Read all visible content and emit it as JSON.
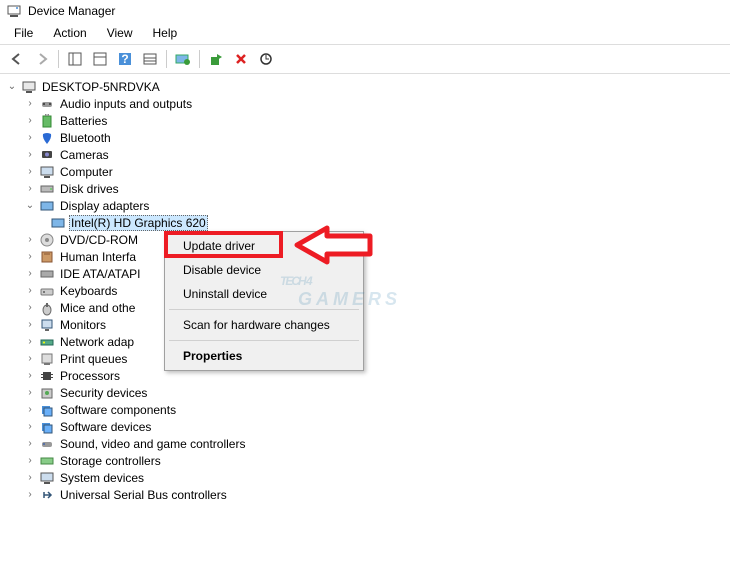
{
  "window": {
    "title": "Device Manager"
  },
  "menu": {
    "file": "File",
    "action": "Action",
    "view": "View",
    "help": "Help"
  },
  "tree": {
    "root": "DESKTOP-5NRDVKA",
    "items": [
      "Audio inputs and outputs",
      "Batteries",
      "Bluetooth",
      "Cameras",
      "Computer",
      "Disk drives",
      "Display adapters",
      "DVD/CD-ROM",
      "Human Interfa",
      "IDE ATA/ATAPI",
      "Keyboards",
      "Mice and othe",
      "Monitors",
      "Network adap",
      "Print queues",
      "Processors",
      "Security devices",
      "Software components",
      "Software devices",
      "Sound, video and game controllers",
      "Storage controllers",
      "System devices",
      "Universal Serial Bus controllers"
    ],
    "display_child": "Intel(R) HD Graphics 620"
  },
  "context_menu": {
    "update": "Update driver",
    "disable": "Disable device",
    "uninstall": "Uninstall device",
    "scan": "Scan for hardware changes",
    "properties": "Properties"
  },
  "watermark": {
    "line1": "TECH 4",
    "line2": "GAMERS"
  }
}
